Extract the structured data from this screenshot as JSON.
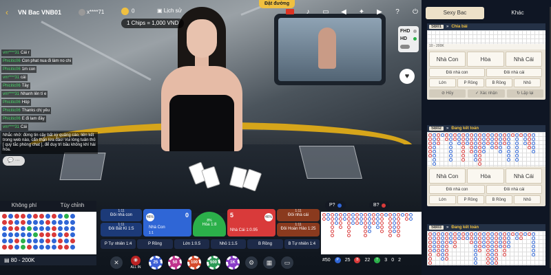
{
  "header": {
    "table_name": "VN Bac VNB01",
    "username": "x****71",
    "balance": "0",
    "history_label": "Lịch sử",
    "chip_value": "1 Chips = 1,000 VND",
    "route_label": "Đặt đường"
  },
  "video": {
    "fhd": "FHD",
    "hd": "HD"
  },
  "chat": {
    "messages": [
      {
        "name": "vm****31",
        "text": "Cái r"
      },
      {
        "name": "Phicitic06",
        "text": "Con phat nua đi làm no chi"
      },
      {
        "name": "Phicitic06",
        "text": "1m con"
      },
      {
        "name": "vm****31",
        "text": "cái"
      },
      {
        "name": "Phicitic06",
        "text": "Tây"
      },
      {
        "name": "vm****31",
        "text": "Nhanh lên tí e"
      },
      {
        "name": "Phicitic06",
        "text": "Hóp"
      },
      {
        "name": "Phicitic06",
        "text": "Thanks chị yêu"
      },
      {
        "name": "Phicitic06",
        "text": "E đi lam đây"
      },
      {
        "name": "vm****31",
        "text": "Cái"
      }
    ],
    "notice": "Nhắc nhở: đừng tin cậy bất kỳ quảng cáo, liên kết trong web nào, cẩn thận lừa đảo! Vui lòng tuân thủ [ quy tắc phòng chat ], để duy trì bầu không khí hài hòa."
  },
  "bottom_left": {
    "tab_free": "Không phí",
    "tab_custom": "Tùy chỉnh",
    "limit": "80 - 200K"
  },
  "bets": {
    "player_pair": {
      "odds": "1:11",
      "label": "Đôi nhà con"
    },
    "player_bonus": {
      "odds": "1:11",
      "label": "Đôi Bất Kì 1:5"
    },
    "player": {
      "label": "Nhà Con",
      "odds": "1:1",
      "score": "0",
      "pct": "46%"
    },
    "tie": {
      "label": "Hòa 1:8",
      "pct": "8%"
    },
    "banker": {
      "label": "Nhà Cái 1:0.95",
      "score": "5",
      "pct": "46%"
    },
    "banker_pair": {
      "odds": "1:11",
      "label": "Đôi nhà cái"
    },
    "perfect_pair": {
      "odds": "1:11",
      "label": "Đôi Hoàn Hảo 1:25"
    },
    "row": [
      "P Tự nhiên 1:4",
      "P Rồng",
      "Lớn 1:0.5",
      "Nhỏ 1:1.5",
      "B Rồng",
      "B Tự nhiên 1:4"
    ]
  },
  "chips": [
    "ALL IN",
    "25",
    "50",
    "100",
    "500",
    "1K"
  ],
  "predict": {
    "player": "P?",
    "banker": "B?"
  },
  "stats": {
    "total": "#50",
    "p": "25",
    "b": "22",
    "t": "3",
    "pp": "0",
    "bp": "2"
  },
  "side": {
    "tabs": [
      "Sexy Bac",
      "Khác"
    ],
    "tables": [
      {
        "id": "SB01",
        "status": "Chia bài",
        "limit": "10 - 200K",
        "main": [
          "Nhà Con",
          "Hòa",
          "Nhà Cái"
        ],
        "sub_row1": [
          "Đôi nhà con",
          "Đôi nhà cái"
        ],
        "sub_row2": [
          "Lớn",
          "P Rồng",
          "B Rồng",
          "Nhỏ"
        ],
        "actions": [
          "Hủy",
          "Xác nhận",
          "Lặp lại"
        ]
      },
      {
        "id": "SB02",
        "status": "Đang kết toán",
        "main": [
          "Nhà Con",
          "Hòa",
          "Nhà Cái"
        ],
        "sub_row1": [
          "Đôi nhà con",
          "Đôi nhà cái"
        ],
        "sub_row2": [
          "Lớn",
          "P Rồng",
          "B Rồng",
          "Nhỏ"
        ]
      },
      {
        "id": "SB03",
        "status": "Đang kết toán"
      }
    ]
  },
  "colors": {
    "player": "#2f66d6",
    "banker": "#d93a3a",
    "tie": "#2bb04a",
    "gold": "#f0c040"
  }
}
